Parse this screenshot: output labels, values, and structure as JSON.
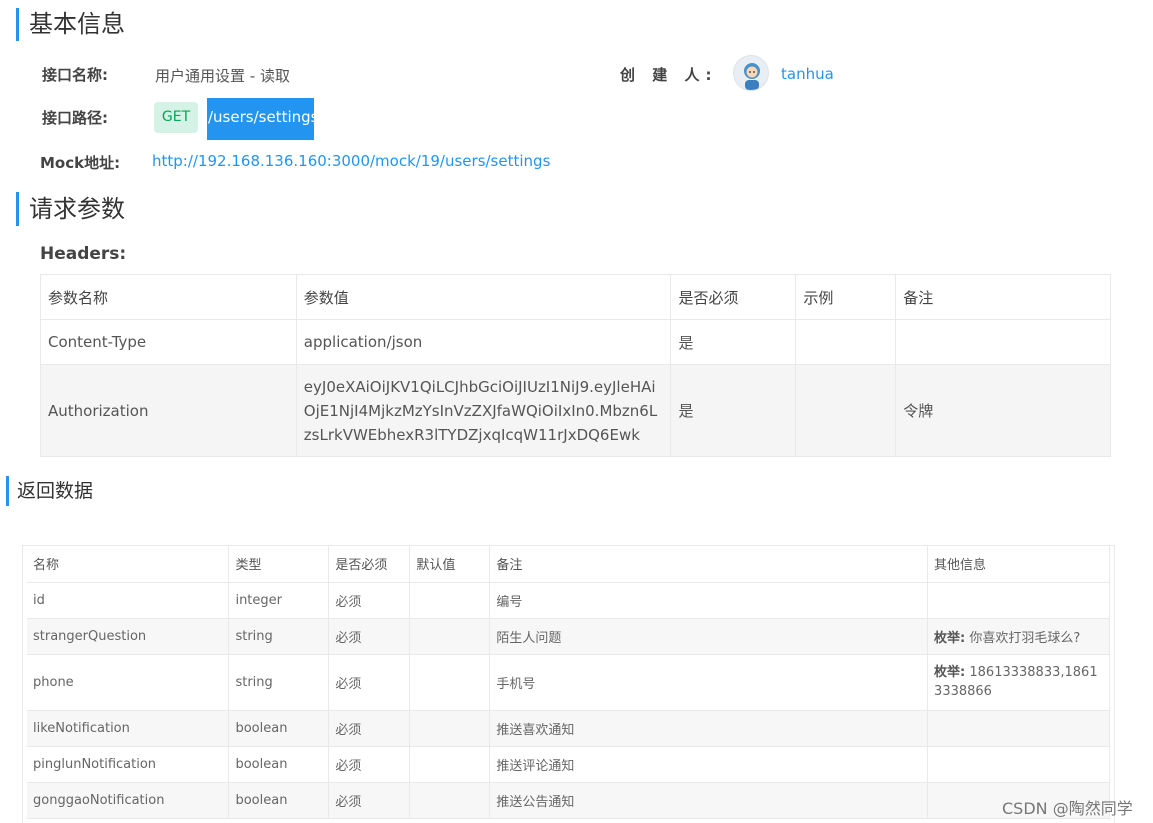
{
  "basic": {
    "title": "基本信息",
    "name_label": "接口名称:",
    "name_value": "用户通用设置 - 读取",
    "creator_label": "创 建 人:",
    "creator_name": "tanhua",
    "path_label": "接口路径:",
    "method": "GET",
    "path": "/users/settings",
    "mock_label": "Mock地址:",
    "mock_url": "http://192.168.136.160:3000/mock/19/users/settings"
  },
  "request": {
    "title": "请求参数",
    "headers_label": "Headers:",
    "columns": [
      "参数名称",
      "参数值",
      "是否必须",
      "示例",
      "备注"
    ],
    "rows": [
      {
        "name": "Content-Type",
        "value": "application/json",
        "required": "是",
        "example": "",
        "note": ""
      },
      {
        "name": "Authorization",
        "value": "eyJ0eXAiOiJKV1QiLCJhbGciOiJIUzI1NiJ9.eyJleHAiOjE1NjI4MjkzMzYsInVzZXJfaWQiOiIxIn0.Mbzn6LzsLrkVWEbhexR3lTYDZjxqIcqW11rJxDQ6Ewk",
        "required": "是",
        "example": "",
        "note": "令牌"
      }
    ]
  },
  "response": {
    "title": "返回数据",
    "columns": [
      "名称",
      "类型",
      "是否必须",
      "默认值",
      "备注",
      "其他信息"
    ],
    "rows": [
      {
        "name": "id",
        "type": "integer",
        "required": "必须",
        "default": "",
        "note": "编号",
        "ex_label": "",
        "ex_value": ""
      },
      {
        "name": "strangerQuestion",
        "type": "string",
        "required": "必须",
        "default": "",
        "note": "陌生人问题",
        "ex_label": "枚举:",
        "ex_value": "你喜欢打羽毛球么?"
      },
      {
        "name": "phone",
        "type": "string",
        "required": "必须",
        "default": "",
        "note": "手机号",
        "ex_label": "枚举:",
        "ex_value": "18613338833,18613338866"
      },
      {
        "name": "likeNotification",
        "type": "boolean",
        "required": "必须",
        "default": "",
        "note": "推送喜欢通知",
        "ex_label": "",
        "ex_value": ""
      },
      {
        "name": "pinglunNotification",
        "type": "boolean",
        "required": "必须",
        "default": "",
        "note": "推送评论通知",
        "ex_label": "",
        "ex_value": ""
      },
      {
        "name": "gonggaoNotification",
        "type": "boolean",
        "required": "必须",
        "default": "",
        "note": "推送公告通知",
        "ex_label": "",
        "ex_value": ""
      }
    ]
  },
  "watermark": "CSDN @陶然同学",
  "colors": {
    "accent": "#2395f1",
    "get_bg": "#d4f2e6",
    "get_text": "#00a854"
  }
}
